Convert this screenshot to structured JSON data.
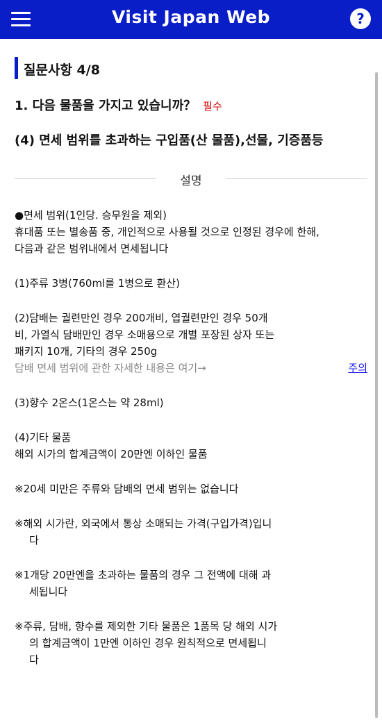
{
  "header": {
    "title": "Visit Japan Web",
    "help_label": "?"
  },
  "section": {
    "title": "질문사항 4/8"
  },
  "question": {
    "text": "1. 다음 물품을 가지고 있습니까？",
    "required": "필수"
  },
  "subquestion": {
    "text": "(4) 면세 범위를 초과하는 구입품(산 물품),선물, 기증품등"
  },
  "description": {
    "label": "설명"
  },
  "content": {
    "p1": [
      "●면세 범위(1인당. 승무원을 제외)",
      "휴대품 또는 별송품 중, 개인적으로 사용될 것으로 인정된 경우에 한해,",
      "다음과 같은 범위내에서 면세됩니다"
    ],
    "p2": [
      "(1)주류 3병(760ml를 1병으로 환산)"
    ],
    "p3": [
      "(2)담배는 궐련만인 경우 200개비, 엽궐련만인 경우 50개",
      "비, 가열식 담배만인 경우 소매용으로 개별 포장된 상자 또는",
      "패키지 10개, 기타의 경우 250g"
    ],
    "p3_gray": "담배 면세 범위에 관한 자세한 내용은 여기→",
    "p3_link": "주의",
    "p4": [
      "(3)향수 2온스(1온스는 약 28ml)"
    ],
    "p5": [
      "(4)기타 물품",
      "해외 시가의 합계금액이 20만엔 이하인 물품"
    ],
    "n1": [
      "※20세 미만은 주류와 담배의 면세 범위는 없습니다"
    ],
    "n2": [
      "※해외 시가란, 외국에서 통상 소매되는 가격(구입가격)입니",
      "다"
    ],
    "n3": [
      "※1개당 20만엔을 초과하는 물품의 경우 그 전액에 대해 과",
      "세됩니다"
    ],
    "n4": [
      "※주류, 담배, 향수를 제외한 기타 물품은 1품목 당 해외 시가",
      "의 합계금액이 1만엔 이하인 경우 원칙적으로 면세됩니",
      "다"
    ]
  }
}
